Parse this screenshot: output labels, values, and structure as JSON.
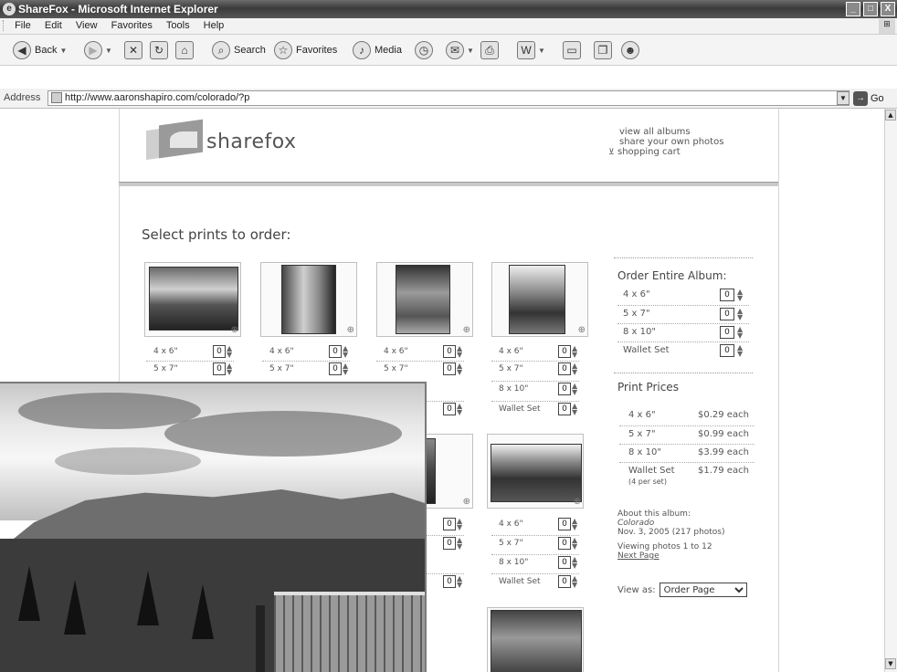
{
  "window": {
    "title": "ShareFox - Microsoft Internet Explorer",
    "controls": [
      "_",
      "□",
      "X"
    ]
  },
  "menu": [
    "File",
    "Edit",
    "View",
    "Favorites",
    "Tools",
    "Help"
  ],
  "toolbar": {
    "back": "Back",
    "search": "Search",
    "favorites": "Favorites",
    "media": "Media"
  },
  "address": {
    "label": "Address",
    "url": "http://www.aaronshapiro.com/colorado/?p",
    "go": "Go"
  },
  "logo": {
    "word": "sharefox"
  },
  "toplinks": [
    "view all albums",
    "share your own photos",
    "shopping cart"
  ],
  "heading": "Select prints to order:",
  "print_rows": [
    [
      {
        "label": "4 x 6\"",
        "qty": "0"
      },
      {
        "label": "5 x 7\"",
        "qty": "0"
      }
    ],
    [
      {
        "label": "4 x 6\"",
        "qty": "0"
      },
      {
        "label": "5 x 7\"",
        "qty": "0"
      }
    ],
    [
      {
        "label": "4 x 6\"",
        "qty": "0"
      },
      {
        "label": "5 x 7\"",
        "qty": "0"
      }
    ],
    [
      {
        "label": "4 x 6\"",
        "qty": "0"
      },
      {
        "label": "5 x 7\"",
        "qty": "0"
      },
      {
        "label": "8 x 10\"",
        "qty": "0"
      },
      {
        "label": "Wallet Set",
        "qty": "0"
      }
    ]
  ],
  "col3_partial_row": {
    "qty": "0"
  },
  "second_row": {
    "col3": [
      {
        "qty": "0"
      },
      {
        "qty": "0"
      },
      {
        "qty": "0"
      }
    ],
    "col4": [
      {
        "label": "4 x 6\"",
        "qty": "0"
      },
      {
        "label": "5 x 7\"",
        "qty": "0"
      },
      {
        "label": "8 x 10\"",
        "qty": "0"
      },
      {
        "label": "Wallet Set",
        "qty": "0"
      }
    ]
  },
  "order_entire": {
    "title": "Order Entire Album:",
    "rows": [
      {
        "label": "4 x 6\"",
        "qty": "0"
      },
      {
        "label": "5 x 7\"",
        "qty": "0"
      },
      {
        "label": "8 x 10\"",
        "qty": "0"
      },
      {
        "label": "Wallet Set",
        "qty": "0"
      }
    ]
  },
  "prices": {
    "title": "Print Prices",
    "rows": [
      {
        "label": "4 x 6\"",
        "price": "$0.29 each"
      },
      {
        "label": "5 x 7\"",
        "price": "$0.99 each"
      },
      {
        "label": "8 x 10\"",
        "price": "$3.99 each"
      },
      {
        "label": "Wallet Set",
        "price": "$1.79 each"
      }
    ],
    "wallet_note": "(4 per set)"
  },
  "about": {
    "label": "About this album:",
    "name": "Colorado",
    "date": "Nov. 3, 2005 (217 photos)",
    "viewing": "Viewing photos 1 to 12",
    "next": "Next Page"
  },
  "view_as": {
    "label": "View as:",
    "selected": "Order Page"
  }
}
